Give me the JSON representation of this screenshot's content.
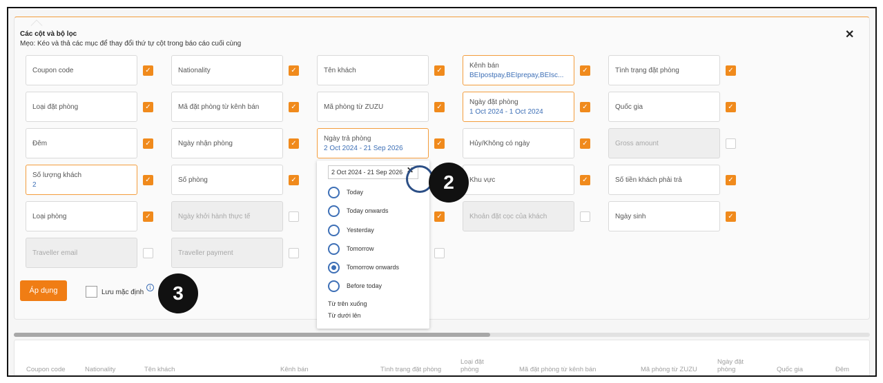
{
  "dialog": {
    "title": "Các cột và bộ lọc",
    "tip": "Mẹo: Kéo và thả các mục để thay đổi thứ tự cột trong báo cáo cuối cùng",
    "close_icon": "close-icon"
  },
  "fields": {
    "coupon_code": {
      "label": "Coupon code",
      "checked": true
    },
    "nationality": {
      "label": "Nationality",
      "checked": true
    },
    "ten_khach": {
      "label": "Tên khách",
      "checked": true
    },
    "kenh_ban": {
      "label": "Kênh bán",
      "value": "BEIpostpay,BEIprepay,BEIsc...",
      "checked": true
    },
    "tinh_trang": {
      "label": "Tình trạng đặt phòng",
      "checked": true
    },
    "loai_dat_phong": {
      "label": "Loại đặt phòng",
      "checked": true
    },
    "ma_dp_kenh_ban": {
      "label": "Mã đặt phòng từ kênh bán",
      "checked": true
    },
    "ma_phong_zuzu": {
      "label": "Mã phòng từ ZUZU",
      "checked": true
    },
    "ngay_dat_phong": {
      "label": "Ngày đặt phòng",
      "value": "1 Oct 2024 - 1 Oct 2024",
      "checked": true
    },
    "quoc_gia": {
      "label": "Quốc gia",
      "checked": true
    },
    "dem": {
      "label": "Đêm",
      "checked": true
    },
    "ngay_nhan_phong": {
      "label": "Ngày nhận phòng",
      "checked": true
    },
    "ngay_tra_phong": {
      "label": "Ngày trả phòng",
      "value": "2 Oct 2024 - 21 Sep 2026",
      "checked": true
    },
    "huy_khong_co_ngay": {
      "label": "Hủy/Không có ngày",
      "checked": true
    },
    "gross_amount": {
      "label": "Gross amount",
      "checked": false
    },
    "so_luong_khach": {
      "label": "Số lượng khách",
      "value": "2",
      "checked": true
    },
    "so_phong": {
      "label": "Số phòng",
      "checked": true
    },
    "khu_vuc": {
      "label": "Khu vực",
      "checked": true
    },
    "so_tien_khach_tra": {
      "label": "Số tiền khách phải trả",
      "checked": true
    },
    "loai_phong": {
      "label": "Loại phòng",
      "checked": true
    },
    "ngay_khoi_hanh": {
      "label": "Ngày khởi hành thực tế",
      "checked": false
    },
    "col3_row5_checked": true,
    "khoan_dat_coc": {
      "label": "Khoản đặt cọc của khách",
      "checked": false
    },
    "ngay_sinh": {
      "label": "Ngày sinh",
      "checked": true
    },
    "traveller_email": {
      "label": "Traveller email",
      "checked": false
    },
    "traveller_payment": {
      "label": "Traveller payment",
      "checked": false
    },
    "col3_row6_checked": false
  },
  "actions": {
    "apply_label": "Áp dụng",
    "save_default_label": "Lưu mặc định",
    "info_icon": "info-icon"
  },
  "date_popup": {
    "range_value": "2 Oct 2024 - 21 Sep 2026",
    "clear_label": "✕",
    "options": [
      {
        "label": "Today",
        "selected": false
      },
      {
        "label": "Today onwards",
        "selected": false
      },
      {
        "label": "Yesterday",
        "selected": false
      },
      {
        "label": "Tomorrow",
        "selected": false
      },
      {
        "label": "Tomorrow onwards",
        "selected": true
      },
      {
        "label": "Before today",
        "selected": false
      }
    ],
    "sort_desc": "Từ trên xuống",
    "sort_asc": "Từ dưới lên"
  },
  "annotations": {
    "step_2": "2",
    "step_3": "3"
  },
  "table_headers": [
    "Coupon code",
    "Nationality",
    "Tên khách",
    "Kênh bán",
    "Tình trạng đặt phòng",
    "Loại đặt phòng",
    "Mã đặt phòng từ kênh bán",
    "Mã phòng từ ZUZU",
    "Ngày đặt phòng",
    "Quốc gia",
    "Đêm"
  ],
  "colors": {
    "accent": "#f08a1c",
    "link": "#3d6fb6"
  }
}
